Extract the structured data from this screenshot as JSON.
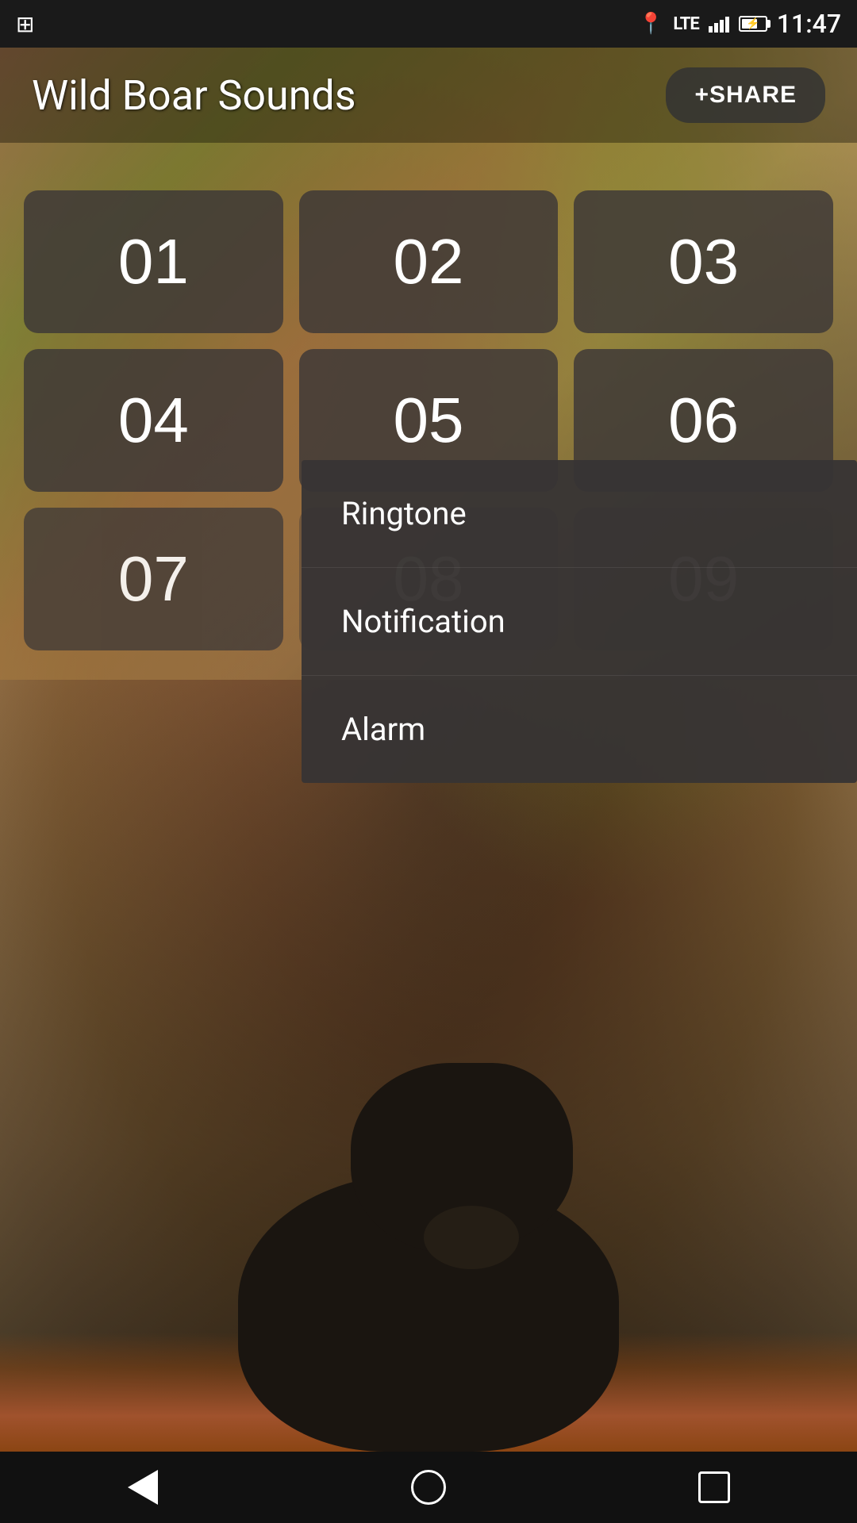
{
  "statusBar": {
    "time": "11:47",
    "lte": "LTE",
    "batteryLevel": 70
  },
  "header": {
    "title": "Wild Boar Sounds",
    "shareButton": "+SHARE"
  },
  "soundButtons": [
    {
      "id": 1,
      "label": "01"
    },
    {
      "id": 2,
      "label": "02"
    },
    {
      "id": 3,
      "label": "03"
    },
    {
      "id": 4,
      "label": "04"
    },
    {
      "id": 5,
      "label": "05"
    },
    {
      "id": 6,
      "label": "06"
    },
    {
      "id": 7,
      "label": "07"
    },
    {
      "id": 8,
      "label": "08"
    },
    {
      "id": 9,
      "label": "09"
    }
  ],
  "contextMenu": {
    "items": [
      {
        "id": "ringtone",
        "label": "Ringtone"
      },
      {
        "id": "notification",
        "label": "Notification"
      },
      {
        "id": "alarm",
        "label": "Alarm"
      }
    ]
  },
  "navBar": {
    "back": "back",
    "home": "home",
    "recents": "recents"
  }
}
